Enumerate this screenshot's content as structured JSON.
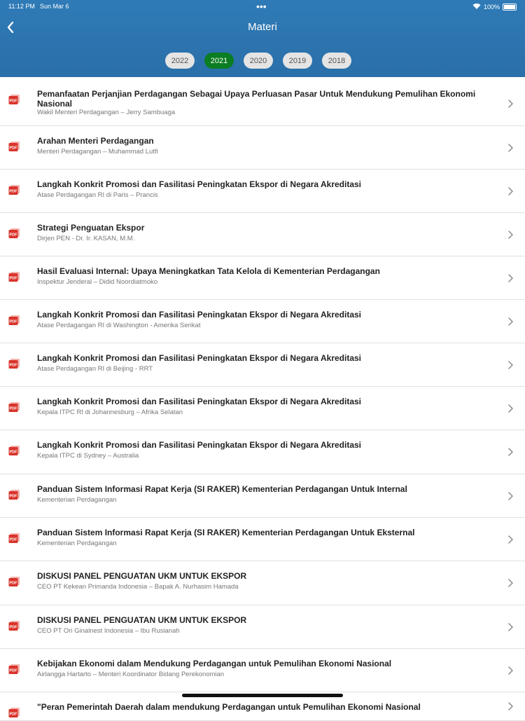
{
  "status_bar": {
    "time": "11:12 PM",
    "date": "Sun Mar 6",
    "battery": "100%"
  },
  "header": {
    "title": "Materi"
  },
  "year_tabs": [
    {
      "label": "2022",
      "active": false
    },
    {
      "label": "2021",
      "active": true
    },
    {
      "label": "2020",
      "active": false
    },
    {
      "label": "2019",
      "active": false
    },
    {
      "label": "2018",
      "active": false
    }
  ],
  "icons": {
    "back": "chevron-left-icon",
    "file": "pdf-icon",
    "disclosure": "chevron-right-icon"
  },
  "colors": {
    "header": "#2f7bb7",
    "active_tab": "#0b7d22",
    "pdf": "#d9342b"
  },
  "items": [
    {
      "title": "Pemanfaatan Perjanjian Perdagangan Sebagai Upaya Perluasan Pasar Untuk Mendukung Pemulihan Ekonomi Nasional",
      "subtitle": "Wakil Menteri Perdagangan – Jerry Sambuaga"
    },
    {
      "title": "Arahan Menteri Perdagangan",
      "subtitle": "Menteri Perdagangan – Muhammad Lutfi"
    },
    {
      "title": "Langkah Konkrit Promosi dan Fasilitasi Peningkatan Ekspor di Negara Akreditasi",
      "subtitle": "Atase Perdagangan RI di Paris – Prancis"
    },
    {
      "title": "Strategi Penguatan Ekspor",
      "subtitle": "Dirjen PEN - Dr. Ir. KASAN, M.M."
    },
    {
      "title": "Hasil Evaluasi Internal: Upaya Meningkatkan Tata Kelola di Kementerian Perdagangan",
      "subtitle": "Inspektur Jenderal – Didid Noordiatmoko"
    },
    {
      "title": "Langkah Konkrit Promosi dan Fasilitasi Peningkatan Ekspor di Negara Akreditasi",
      "subtitle": "Atase Perdagangan RI di Washington - Amerika Serikat"
    },
    {
      "title": "Langkah Konkrit Promosi dan Fasilitasi Peningkatan Ekspor di Negara Akreditasi",
      "subtitle": "Atase Perdagangan RI di Beijing - RRT"
    },
    {
      "title": "Langkah Konkrit Promosi dan Fasilitasi Peningkatan Ekspor di Negara Akreditasi",
      "subtitle": "Kepala ITPC RI di Johannesburg – Afrika Selatan"
    },
    {
      "title": "Langkah Konkrit Promosi dan Fasilitasi Peningkatan Ekspor di Negara Akreditasi",
      "subtitle": "Kepala ITPC di Sydney – Australia"
    },
    {
      "title": "Panduan Sistem Informasi Rapat Kerja (SI RAKER) Kementerian Perdagangan Untuk Internal",
      "subtitle": "Kementerian Perdagangan"
    },
    {
      "title": "Panduan Sistem Informasi Rapat Kerja (SI RAKER) Kementerian Perdagangan Untuk Eksternal",
      "subtitle": "Kementerian Perdagangan"
    },
    {
      "title": "DISKUSI PANEL PENGUATAN UKM UNTUK EKSPOR",
      "subtitle": "CEO PT Kekean Primanda Indonesia – Bapak A. Nurhasim Hamada"
    },
    {
      "title": "DISKUSI PANEL PENGUATAN UKM UNTUK EKSPOR",
      "subtitle": "CEO PT Ori Ginalnest Indonesia – Ibu Rusianah"
    },
    {
      "title": "Kebijakan Ekonomi dalam Mendukung Perdagangan untuk Pemulihan Ekonomi Nasional",
      "subtitle": "Airlangga Hartarto – Menteri Koordinator Bidang Perekonomian"
    },
    {
      "title": "\"Peran Pemerintah Daerah dalam mendukung Perdagangan untuk Pemulihan Ekonomi Nasional",
      "subtitle": ""
    }
  ]
}
